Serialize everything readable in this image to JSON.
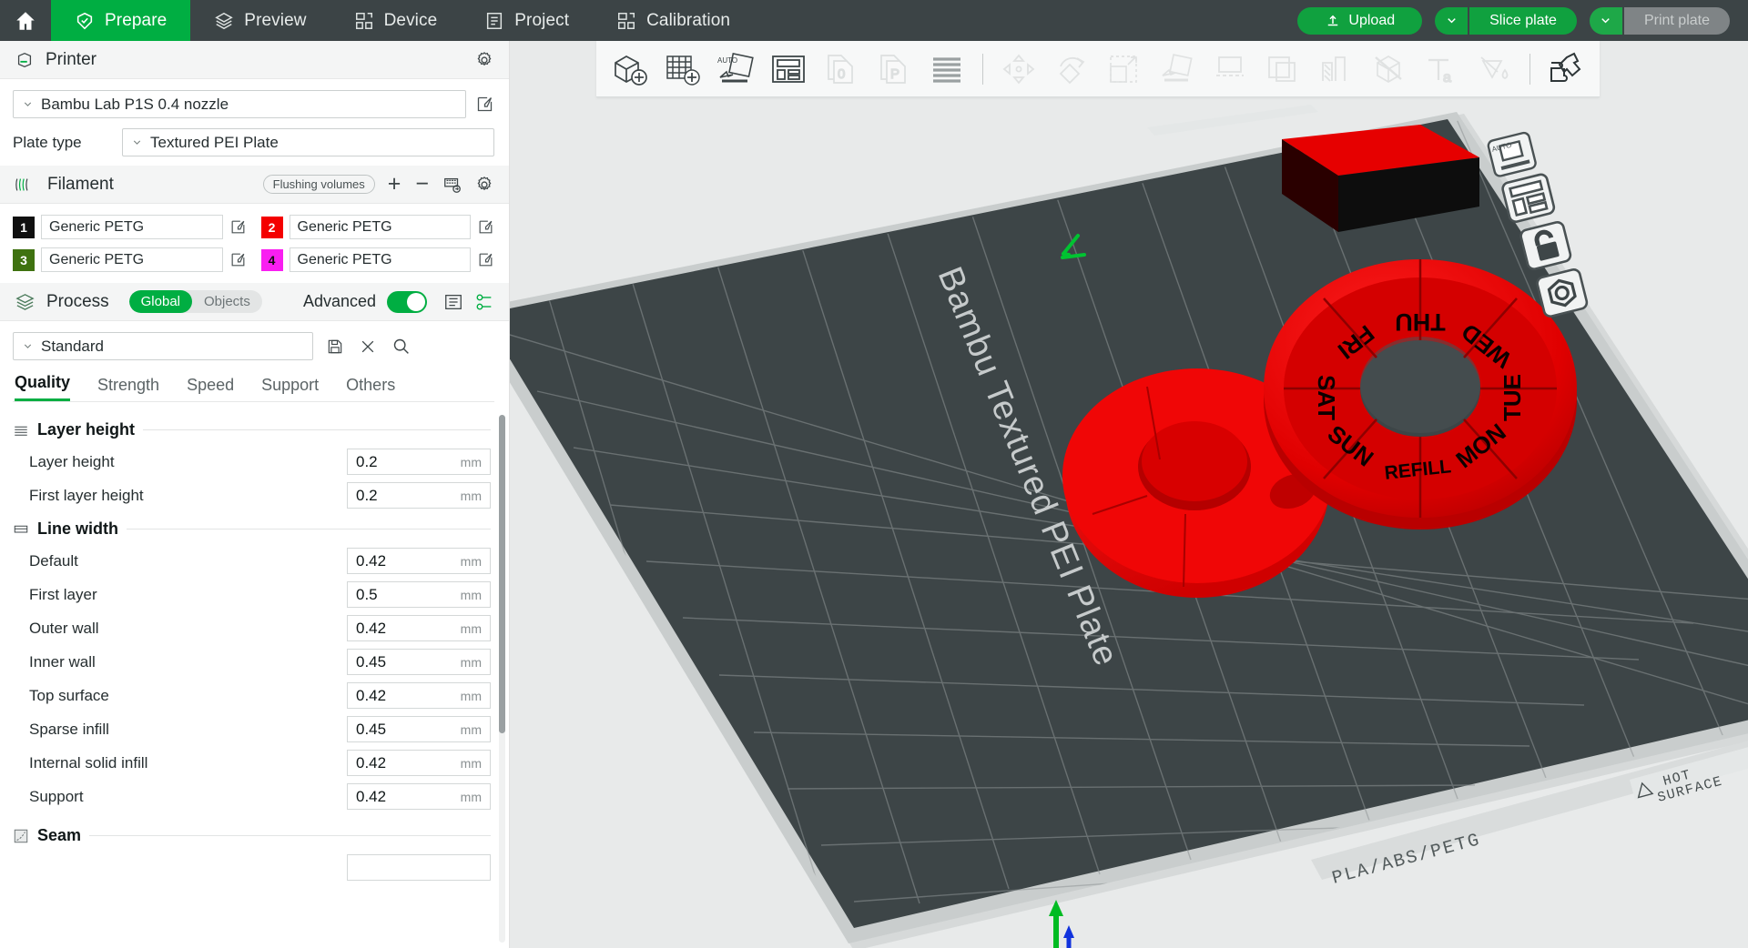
{
  "app": {
    "home_icon": "home-icon"
  },
  "nav": {
    "tabs": [
      {
        "label": "Prepare",
        "icon": "prepare-icon",
        "active": true
      },
      {
        "label": "Preview",
        "icon": "preview-icon",
        "active": false
      },
      {
        "label": "Device",
        "icon": "device-icon",
        "active": false
      },
      {
        "label": "Project",
        "icon": "project-icon",
        "active": false
      },
      {
        "label": "Calibration",
        "icon": "calibration-icon",
        "active": false
      }
    ]
  },
  "top_actions": {
    "upload_label": "Upload",
    "upload_icon": "upload-icon",
    "slice_label": "Slice plate",
    "slice_caret_icon": "chevron-down-icon",
    "print_label": "Print plate",
    "print_caret_icon": "chevron-down-icon",
    "print_disabled": true
  },
  "sidebar": {
    "printer": {
      "section_title": "Printer",
      "section_icon": "printer-icon",
      "gear_icon": "gear-icon",
      "preset": "Bambu Lab P1S 0.4 nozzle",
      "preset_caret": "chevron-down-icon",
      "edit_icon": "edit-icon",
      "plate_type_label": "Plate type",
      "plate_type_value": "Textured PEI Plate"
    },
    "filament": {
      "section_title": "Filament",
      "section_icon": "filament-icon",
      "flushing_label": "Flushing volumes",
      "add_icon": "plus-icon",
      "remove_icon": "minus-icon",
      "ams_icon": "ams-icon",
      "gear_icon": "gear-icon",
      "items": [
        {
          "index": "1",
          "name": "Generic PETG",
          "color": "#101010",
          "text_color": "#ffffff"
        },
        {
          "index": "2",
          "name": "Generic PETG",
          "color": "#f40000",
          "text_color": "#ffffff"
        },
        {
          "index": "3",
          "name": "Generic PETG",
          "color": "#3f7210",
          "text_color": "#ffffff"
        },
        {
          "index": "4",
          "name": "Generic PETG",
          "color": "#f91ef1",
          "text_color": "#101010"
        }
      ]
    },
    "process": {
      "section_title": "Process",
      "section_icon": "process-icon",
      "scope_global": "Global",
      "scope_objects": "Objects",
      "advanced_label": "Advanced",
      "advanced_on": true,
      "list_icon": "list-icon",
      "compare_icon": "compare-icon",
      "preset": "Standard",
      "preset_caret": "chevron-down-icon",
      "save_icon": "save-icon",
      "close_icon": "close-icon",
      "search_icon": "search-icon",
      "tabs": [
        {
          "label": "Quality",
          "active": true
        },
        {
          "label": "Strength",
          "active": false
        },
        {
          "label": "Speed",
          "active": false
        },
        {
          "label": "Support",
          "active": false
        },
        {
          "label": "Others",
          "active": false
        }
      ],
      "groups": [
        {
          "title": "Layer height",
          "icon": "layer-height-icon",
          "rows": [
            {
              "label": "Layer height",
              "value": "0.2",
              "unit": "mm"
            },
            {
              "label": "First layer height",
              "value": "0.2",
              "unit": "mm"
            }
          ]
        },
        {
          "title": "Line width",
          "icon": "line-width-icon",
          "rows": [
            {
              "label": "Default",
              "value": "0.42",
              "unit": "mm"
            },
            {
              "label": "First layer",
              "value": "0.5",
              "unit": "mm"
            },
            {
              "label": "Outer wall",
              "value": "0.42",
              "unit": "mm"
            },
            {
              "label": "Inner wall",
              "value": "0.45",
              "unit": "mm"
            },
            {
              "label": "Top surface",
              "value": "0.42",
              "unit": "mm"
            },
            {
              "label": "Sparse infill",
              "value": "0.45",
              "unit": "mm"
            },
            {
              "label": "Internal solid infill",
              "value": "0.42",
              "unit": "mm"
            },
            {
              "label": "Support",
              "value": "0.42",
              "unit": "mm"
            }
          ]
        },
        {
          "title": "Seam",
          "icon": "seam-icon",
          "rows": []
        }
      ]
    }
  },
  "viewport": {
    "toolbar": [
      {
        "name": "add-object-icon",
        "dim": false
      },
      {
        "name": "add-plate-icon",
        "dim": false
      },
      {
        "name": "auto-orient-icon",
        "dim": false
      },
      {
        "name": "arrange-icon",
        "dim": false
      },
      {
        "name": "copy-icon",
        "dim": true
      },
      {
        "name": "paste-icon",
        "dim": true
      },
      {
        "name": "variable-layer-height-icon",
        "dim": false
      },
      {
        "name": "separator",
        "dim": false
      },
      {
        "name": "move-icon",
        "dim": true
      },
      {
        "name": "rotate-icon",
        "dim": true
      },
      {
        "name": "scale-icon",
        "dim": true
      },
      {
        "name": "lay-on-face-icon",
        "dim": true
      },
      {
        "name": "cut-icon",
        "dim": true
      },
      {
        "name": "mesh-boolean-icon",
        "dim": true
      },
      {
        "name": "support-painting-icon",
        "dim": true
      },
      {
        "name": "seam-painting-icon",
        "dim": true
      },
      {
        "name": "text-icon",
        "dim": true
      },
      {
        "name": "color-painting-icon",
        "dim": true
      },
      {
        "name": "separator",
        "dim": false
      },
      {
        "name": "assembly-view-icon",
        "dim": false
      }
    ],
    "plate_label": "Bambu Textured PEI Plate",
    "plate_material_label": "PLA/ABS/PETG",
    "hot_surface_line1": "HOT",
    "hot_surface_line2": "SURFACE",
    "edit_pencil_icon": "edit-pencil-icon",
    "plate_side_icons": [
      "auto-orient-plate-icon",
      "arrange-plate-icon",
      "lock-plate-icon",
      "plate-settings-icon"
    ],
    "objects": [
      {
        "name": "weekly-pill-organizer-ring",
        "color": "#ef0000",
        "labels": [
          "THU",
          "WED",
          "TUE",
          "MON",
          "REFILL",
          "SUN",
          "SAT",
          "FRI"
        ]
      },
      {
        "name": "pill-organizer-lid",
        "color": "#ef0000",
        "labels": []
      },
      {
        "name": "red-black-block",
        "color_top": "#e60000",
        "color_side": "#101010",
        "labels": []
      }
    ]
  }
}
